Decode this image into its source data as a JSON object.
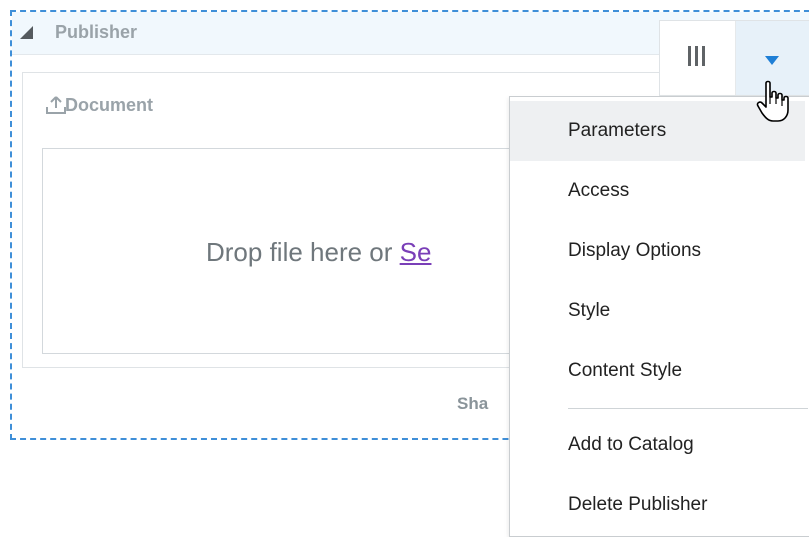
{
  "publisher": {
    "title": "Publisher"
  },
  "document": {
    "title": "Document",
    "drop_text_prefix": "Drop file here or ",
    "drop_link_text": "Se",
    "share_text": "Sha"
  },
  "menu": {
    "items": [
      {
        "label": "Parameters",
        "highlighted": true
      },
      {
        "label": "Access",
        "highlighted": false
      },
      {
        "label": "Display Options",
        "highlighted": false
      },
      {
        "label": "Style",
        "highlighted": false
      },
      {
        "label": "Content Style",
        "highlighted": false
      },
      {
        "label": "Add to Catalog",
        "highlighted": false
      },
      {
        "label": "Delete Publisher",
        "highlighted": false
      }
    ]
  },
  "icons": {
    "collapse": "collapse-triangle-icon",
    "upload": "upload-icon",
    "columns": "columns-icon",
    "dropdown": "dropdown-arrow-icon",
    "cursor": "hand-cursor-icon"
  },
  "colors": {
    "frame_border": "#3f8fd8",
    "header_bg": "#f1f8fd",
    "accent_blue": "#1f7fd6",
    "link_purple": "#7a3fb8",
    "menu_highlight": "#eef0f2"
  }
}
